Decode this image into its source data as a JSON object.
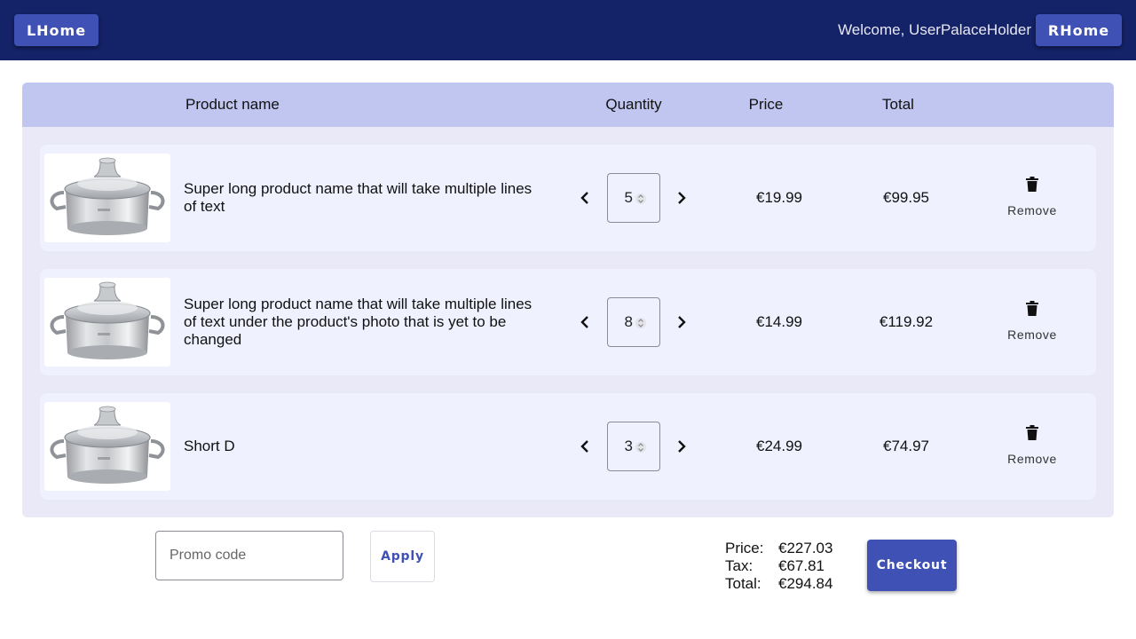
{
  "header": {
    "left_button_label": "LHome",
    "welcome_text": "Welcome, UserPalaceHolder",
    "right_button_label": "RHome"
  },
  "table": {
    "headers": {
      "product_name": "Product name",
      "quantity": "Quantity",
      "price": "Price",
      "total": "Total"
    },
    "rows": [
      {
        "image": "cooking-pot-photo",
        "name": "Super long product name that will take multiple lines of text",
        "quantity": "5",
        "price": "€19.99",
        "total": "€99.95",
        "remove_label": "Remove"
      },
      {
        "image": "cooking-pot-photo",
        "name": "Super long product name that will take multiple lines of text under the product's photo that is yet to be changed",
        "quantity": "8",
        "price": "€14.99",
        "total": "€119.92",
        "remove_label": "Remove"
      },
      {
        "image": "cooking-pot-photo",
        "name": "Short D",
        "quantity": "3",
        "price": "€24.99",
        "total": "€74.97",
        "remove_label": "Remove"
      }
    ],
    "icons": {
      "decrease": "chevron-left-icon",
      "increase": "chevron-right-icon",
      "remove": "trash-icon"
    }
  },
  "promo": {
    "placeholder": "Promo code",
    "value": "",
    "apply_label": "Apply"
  },
  "summary": {
    "price_label": "Price:",
    "price_value": "€227.03",
    "tax_label": "Tax:",
    "tax_value": "€67.81",
    "total_label": "Total:",
    "total_value": "€294.84"
  },
  "checkout_label": "Checkout",
  "colors": {
    "header_bg": "#142267",
    "primary": "#3f51b5",
    "table_header_bg": "#c0c6f0",
    "table_bg": "#e9e9f8",
    "row_bg": "#eff1fe"
  }
}
